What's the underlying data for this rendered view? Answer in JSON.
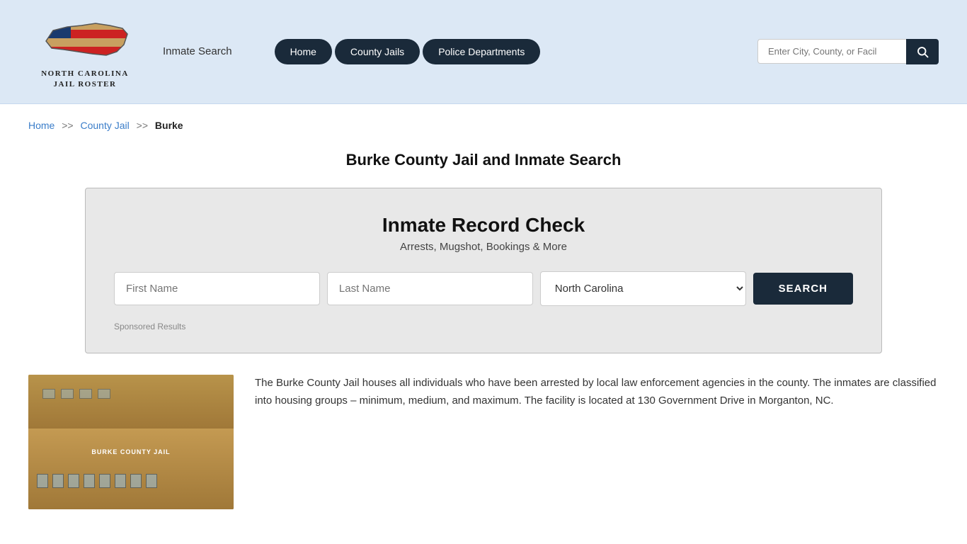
{
  "header": {
    "logo_line1": "NORTH CAROLINA",
    "logo_line2": "JAIL ROSTER",
    "inmate_search_label": "Inmate Search",
    "nav": {
      "home": "Home",
      "county_jails": "County Jails",
      "police_departments": "Police Departments"
    },
    "search_placeholder": "Enter City, County, or Facil"
  },
  "breadcrumb": {
    "home": "Home",
    "sep1": ">>",
    "county_jail": "County Jail",
    "sep2": ">>",
    "current": "Burke"
  },
  "page_title": "Burke County Jail and Inmate Search",
  "record_check": {
    "title": "Inmate Record Check",
    "subtitle": "Arrests, Mugshot, Bookings & More",
    "first_name_placeholder": "First Name",
    "last_name_placeholder": "Last Name",
    "state_value": "North Carolina",
    "search_button": "SEARCH",
    "sponsored_label": "Sponsored Results"
  },
  "description": {
    "text": "The Burke County Jail houses all individuals who have been arrested by local law enforcement agencies in the county. The inmates are classified into housing groups – minimum, medium, and maximum. The facility is located at 130 Government Drive in Morganton, NC."
  }
}
